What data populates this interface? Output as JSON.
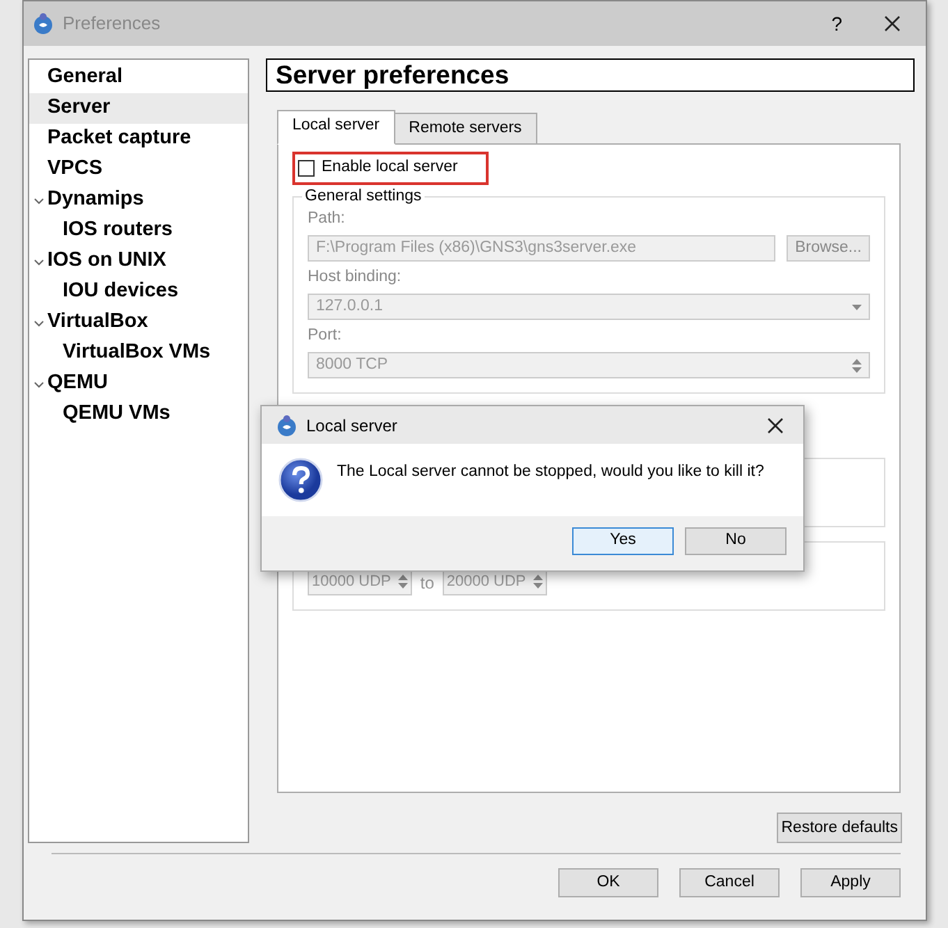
{
  "window": {
    "title": "Preferences",
    "help": "?"
  },
  "sidebar": {
    "items": [
      {
        "label": "General",
        "selected": false
      },
      {
        "label": "Server",
        "selected": true
      },
      {
        "label": "Packet capture",
        "selected": false
      },
      {
        "label": "VPCS",
        "selected": false
      },
      {
        "label": "Dynamips",
        "selected": false,
        "expanded": true,
        "children": [
          {
            "label": "IOS routers",
            "selected": false
          }
        ]
      },
      {
        "label": "IOS on UNIX",
        "selected": false,
        "expanded": true,
        "children": [
          {
            "label": "IOU devices",
            "selected": false
          }
        ]
      },
      {
        "label": "VirtualBox",
        "selected": false,
        "expanded": true,
        "children": [
          {
            "label": "VirtualBox VMs",
            "selected": false
          }
        ]
      },
      {
        "label": "QEMU",
        "selected": false,
        "expanded": true,
        "children": [
          {
            "label": "QEMU VMs",
            "selected": false
          }
        ]
      }
    ]
  },
  "page_title": "Server preferences",
  "tabs": [
    {
      "label": "Local server",
      "selected": true
    },
    {
      "label": "Remote servers",
      "selected": false
    }
  ],
  "enable_checkbox": {
    "label": "Enable local server",
    "checked": false,
    "highlighted": true
  },
  "general_settings": {
    "title": "General settings",
    "disabled": true,
    "fields": [
      {
        "kind": "browse",
        "label": "Path:",
        "value": "F:\\Program Files (x86)\\GNS3\\gns3server.exe",
        "button": "Browse..."
      },
      {
        "kind": "select",
        "label": "Host binding:",
        "value": "127.0.0.1"
      },
      {
        "kind": "spin",
        "label": "Port:",
        "value": "8000 TCP"
      }
    ]
  },
  "port_range": {
    "from": "10000 UDP",
    "separator": "to",
    "to": "20000 UDP"
  },
  "restore_button": "Restore defaults",
  "footer_buttons": [
    "OK",
    "Cancel",
    "Apply"
  ],
  "dialog": {
    "title": "Local server",
    "message": "The Local server cannot be stopped, would you like to kill it?",
    "buttons": [
      {
        "label": "Yes",
        "default": true
      },
      {
        "label": "No",
        "default": false
      }
    ]
  }
}
